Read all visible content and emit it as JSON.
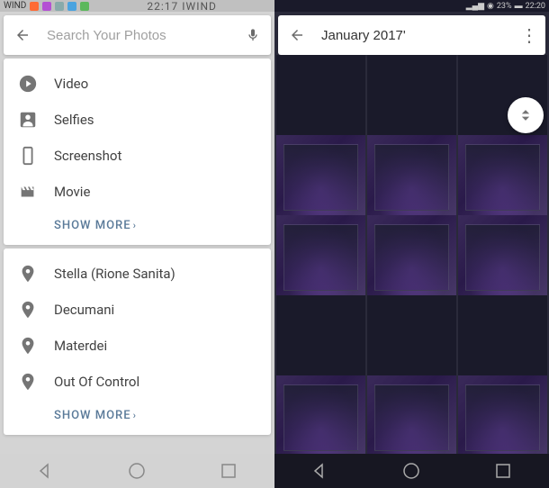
{
  "left": {
    "status": {
      "carrier": "WIND",
      "time": "22:17",
      "carrier2": "IWIND"
    },
    "search": {
      "placeholder": "Search Your Photos"
    },
    "card1": {
      "items": [
        {
          "label": "Video",
          "icon": "play-icon"
        },
        {
          "label": "Selfies",
          "icon": "person-icon"
        },
        {
          "label": "Screenshot",
          "icon": "phone-icon"
        },
        {
          "label": "Movie",
          "icon": "movie-icon"
        }
      ],
      "show_more": "SHOW MORE"
    },
    "card2": {
      "items": [
        {
          "label": "Stella (Rione Sanita)",
          "icon": "pin-icon"
        },
        {
          "label": "Decumani",
          "icon": "pin-icon"
        },
        {
          "label": "Materdei",
          "icon": "pin-icon"
        },
        {
          "label": "Out Of Control",
          "icon": "pin-icon"
        }
      ],
      "show_more": "SHOW MORE"
    }
  },
  "right": {
    "status": {
      "signal": "ll",
      "battery": "23%",
      "time": "22:20"
    },
    "search": {
      "value": "January 2017'"
    },
    "thumb_count": 15
  }
}
